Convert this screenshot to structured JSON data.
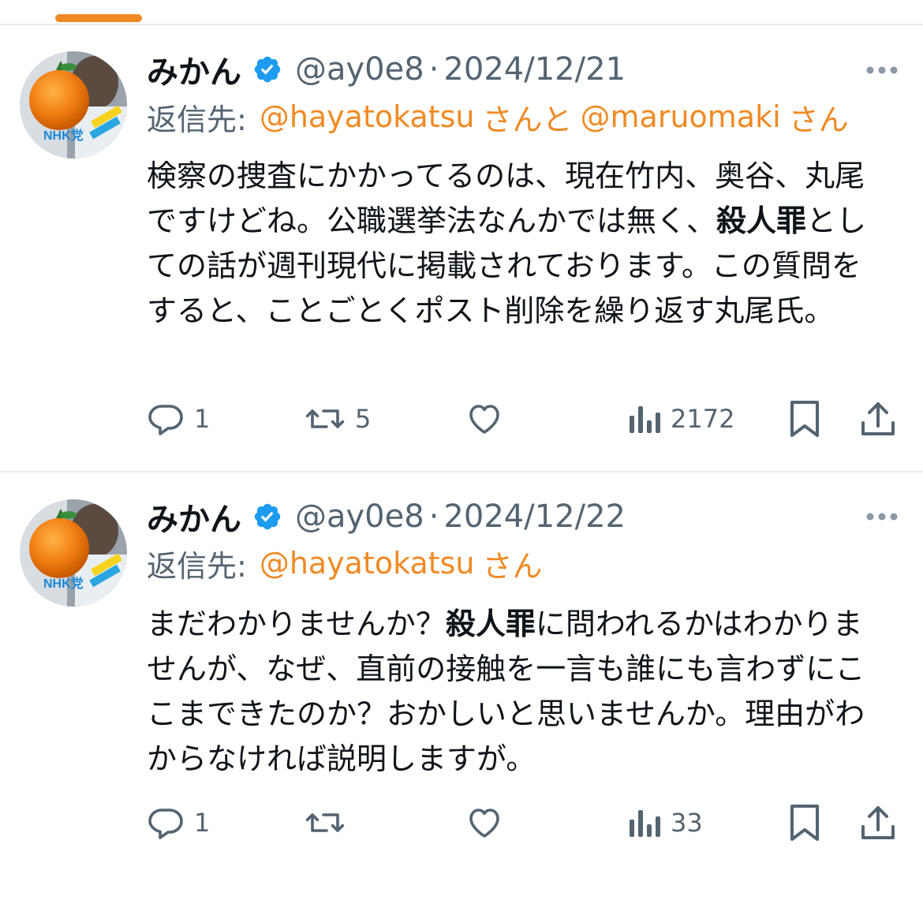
{
  "colors": {
    "accent": "#f08a24",
    "text_primary": "#0f1419",
    "text_secondary": "#536471",
    "verified": "#1d9bf0",
    "divider": "#e9ecef"
  },
  "avatar_badge": "NHK党",
  "tweets": [
    {
      "display_name": "みかん",
      "handle": "@ay0e8",
      "separator": "·",
      "date": "2024/12/21",
      "reply_prefix": "返信先:",
      "reply_mention_1": "@hayatokatsu",
      "reply_join": "さんと",
      "reply_mention_2": "@maruomaki",
      "reply_suffix": "さん",
      "body_part_1": "検察の捜査にかかってるのは、現在竹内、奥谷、丸尾ですけどね。公職選挙法なんかでは無く、",
      "body_bold": "殺人罪",
      "body_part_2": "としての話が週刊現代に掲載されております。この質問をすると、ことごとくポスト削除を繰り返す丸尾氏。",
      "replies": "1",
      "reposts": "5",
      "likes": "",
      "views": "2172",
      "icons": [
        "reply-icon",
        "repost-icon",
        "like-icon",
        "views-icon",
        "bookmark-icon",
        "share-icon"
      ]
    },
    {
      "display_name": "みかん",
      "handle": "@ay0e8",
      "separator": "·",
      "date": "2024/12/22",
      "reply_prefix": "返信先:",
      "reply_mention_1": "@hayatokatsu",
      "reply_suffix": "さん",
      "body_part_1": "まだわかりませんか？",
      "body_bold": "殺人罪",
      "body_part_2": "に問われるかはわかりませんが、なぜ、直前の接触を一言も誰にも言わずにここまできたのか？おかしいと思いませんか。理由がわからなければ説明しますが。",
      "replies": "1",
      "reposts": "",
      "likes": "",
      "views": "33",
      "icons": [
        "reply-icon",
        "repost-icon",
        "like-icon",
        "views-icon",
        "bookmark-icon",
        "share-icon"
      ]
    }
  ]
}
